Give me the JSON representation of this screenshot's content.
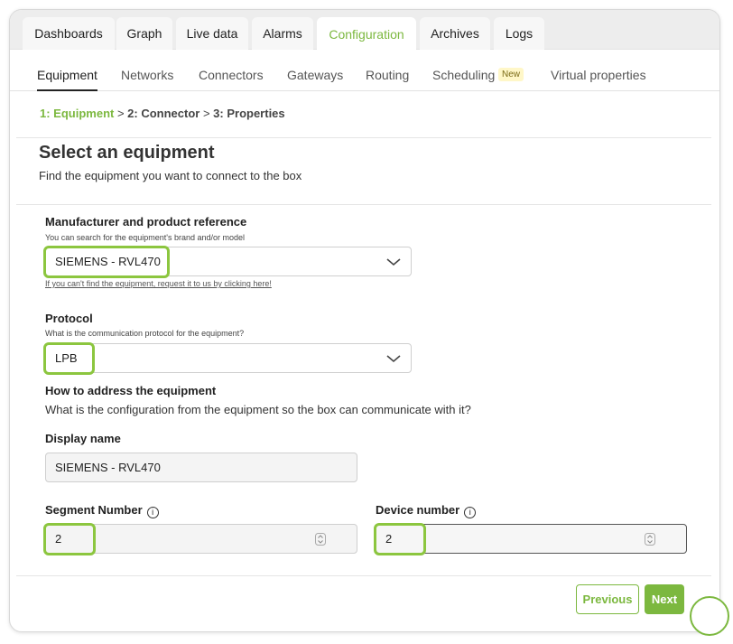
{
  "tabs": [
    "Dashboards",
    "Graph",
    "Live data",
    "Alarms",
    "Configuration",
    "Archives",
    "Logs"
  ],
  "subnav": {
    "items": [
      "Equipment",
      "Networks",
      "Connectors",
      "Gateways",
      "Routing",
      "Scheduling",
      "Virtual properties"
    ],
    "badge": "New"
  },
  "steps": {
    "step1": "1:  Equipment",
    "sep1": " > ",
    "step2": "2:  Connector",
    "sep2": " > ",
    "step3": "3:  Properties"
  },
  "header": {
    "title": "Select an equipment",
    "subtitle": "Find the equipment you want to connect to the box"
  },
  "manufacturer": {
    "label": "Manufacturer and product reference",
    "hint": "You can search for the equipment's brand and/or model",
    "value": "SIEMENS - RVL470",
    "link": "If you can't find the equipment, request it to us by clicking here!"
  },
  "protocol": {
    "label": "Protocol",
    "hint": "What is the communication protocol for the equipment?",
    "value": "LPB"
  },
  "addressing": {
    "title": "How to address the equipment",
    "subtitle": "What is the configuration from the equipment so the box can communicate with it?"
  },
  "display_name": {
    "label": "Display name",
    "value": "SIEMENS - RVL470"
  },
  "segment": {
    "label": "Segment Number",
    "value": "2"
  },
  "device": {
    "label": "Device number",
    "value": "2"
  },
  "info_glyph": "i",
  "buttons": {
    "previous": "Previous",
    "next": "Next"
  },
  "colors": {
    "accent": "#7cb83f",
    "highlight": "#8cc63f"
  }
}
